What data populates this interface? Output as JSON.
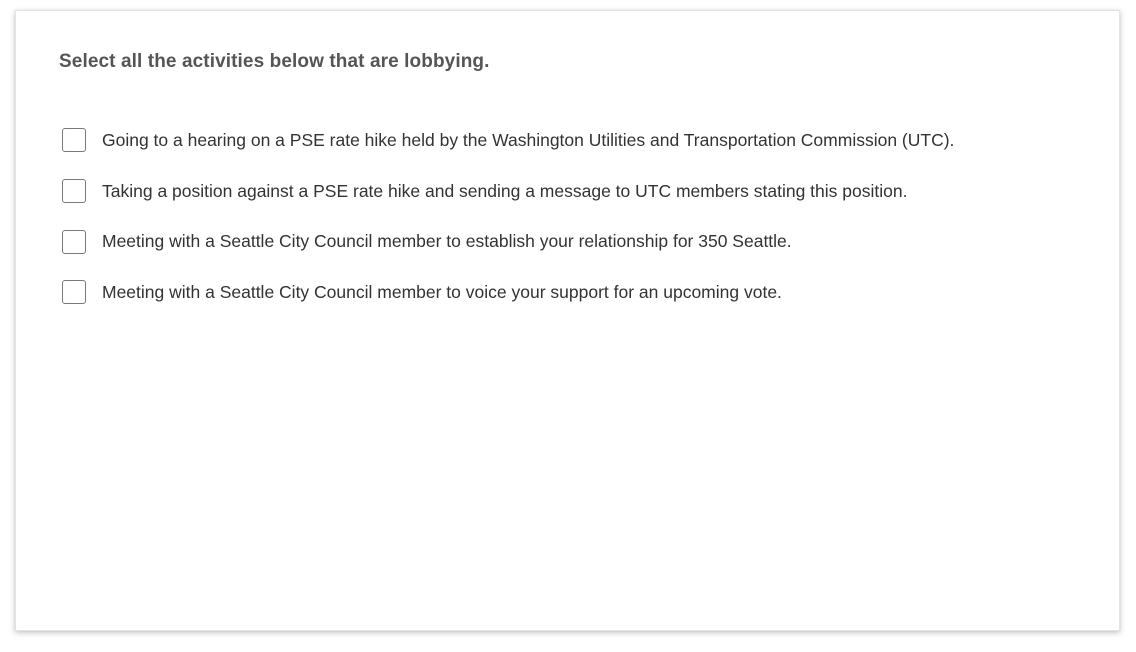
{
  "question": {
    "prompt": "Select all the activities below that are lobbying."
  },
  "options": [
    {
      "label": "Going to a hearing on a PSE rate hike held by the Washington Utilities and Transportation Commission (UTC).",
      "checked": false
    },
    {
      "label": "Taking a position against a PSE rate hike and sending a message to UTC members stating this position.",
      "checked": false
    },
    {
      "label": "Meeting with a Seattle City Council member to establish your relationship for 350 Seattle.",
      "checked": false
    },
    {
      "label": "Meeting with a Seattle City Council member to voice your support for an upcoming vote.",
      "checked": false
    }
  ]
}
